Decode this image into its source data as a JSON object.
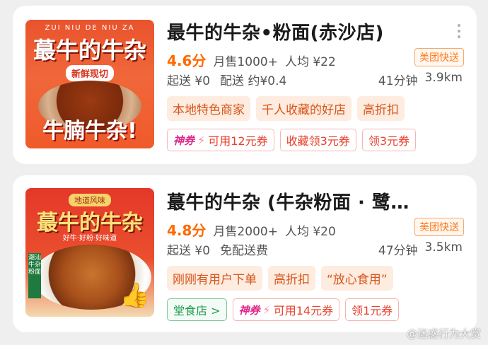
{
  "stores": [
    {
      "thumbnail": {
        "pinyin": "ZUI NIU DE NIU ZA",
        "brand": "蕞牛的牛杂",
        "subtitle": "新鲜现切",
        "slogan": "牛腩牛杂!"
      },
      "title": "最牛的牛杂•粉面(赤沙店)",
      "rating": "4.6分",
      "monthly_sales": "月售1000+",
      "avg_price": "人均 ¥22",
      "delivery_badge": "美团快送",
      "min_order": "起送 ¥0",
      "delivery_fee": "配送 约¥0.4",
      "eta": "41分钟",
      "distance": "3.9km",
      "tags": [
        "本地特色商家",
        "千人收藏的好店",
        "高折扣"
      ],
      "coupons": [
        {
          "type": "shenquan",
          "brand": "神券",
          "text": "可用12元券"
        },
        {
          "type": "plain",
          "text": "收藏领3元券"
        },
        {
          "type": "plain",
          "text": "领3元券"
        }
      ]
    },
    {
      "thumbnail": {
        "top_label": "地道风味",
        "brand": "蕞牛的牛杂",
        "line": "好牛·好粉·好味道",
        "flag": "潮汕牛杂粉面"
      },
      "title": "蕞牛的牛杂 (牛杂粉面 · 鹭…",
      "rating": "4.8分",
      "monthly_sales": "月售2000+",
      "avg_price": "人均 ¥20",
      "delivery_badge": "美团快送",
      "min_order": "起送 ¥0",
      "delivery_fee": "免配送费",
      "eta": "47分钟",
      "distance": "3.5km",
      "tags": [
        "刚刚有用户下单",
        "高折扣",
        "“放心食用”"
      ],
      "dine_in": "堂食店 >",
      "coupons": [
        {
          "type": "shenquan",
          "brand": "神券",
          "text": "可用14元券"
        },
        {
          "type": "plain",
          "text": "领1元券"
        }
      ]
    }
  ],
  "watermark": "@迷惑行为大赏",
  "colors": {
    "accent": "#ff6a00",
    "tag_bg": "#fdecdf",
    "coupon_red": "#e8412d"
  }
}
